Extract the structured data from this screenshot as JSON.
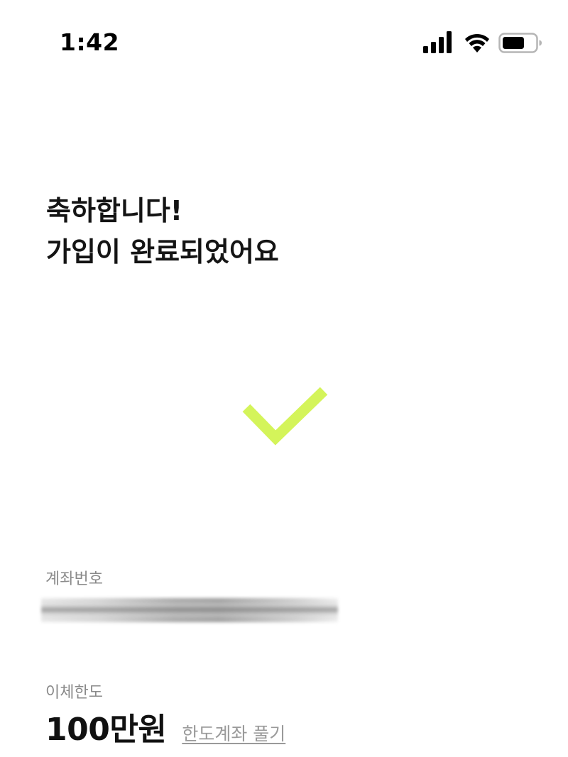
{
  "status_bar": {
    "time": "1:42",
    "icons": [
      "signal-icon",
      "wifi-icon",
      "battery-icon"
    ],
    "battery_level": 0.7
  },
  "headline": {
    "line1": "축하합니다!",
    "line2": "가입이 완료되었어요"
  },
  "success_icon": {
    "name": "checkmark-icon",
    "color": "#d4f45a"
  },
  "account": {
    "label": "계좌번호"
  },
  "transfer_limit": {
    "label": "이체한도",
    "value": "100만원",
    "link": "한도계좌 풀기"
  },
  "colors": {
    "text": "#141414",
    "secondary_text": "#8a8a8a",
    "accent": "#d4f45a",
    "background": "#ffffff"
  }
}
